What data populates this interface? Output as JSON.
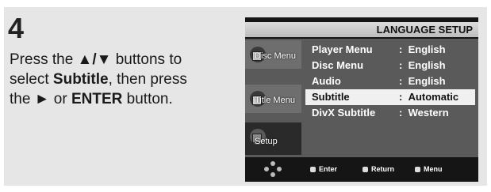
{
  "step": {
    "number": "4"
  },
  "instructions": {
    "line1_pre": "Press the ",
    "arrows": "▲/▼",
    "line1_post": " buttons to",
    "line2_pre": "select ",
    "line2_bold": "Subtitle",
    "line2_post": ", then press",
    "line3_pre": "the ",
    "line3_arrow": "►",
    "line3_mid": " or ",
    "line3_bold": "ENTER",
    "line3_post": " button."
  },
  "osd": {
    "title": "LANGUAGE SETUP",
    "side_tabs": [
      {
        "label": "Disc Menu",
        "icon": "disc-menu-icon"
      },
      {
        "label": "Title Menu",
        "icon": "title-menu-icon"
      },
      {
        "label": "Setup",
        "icon": "setup-icon"
      }
    ],
    "menu": [
      {
        "label": "Player Menu",
        "sep": ":",
        "value": "English",
        "selected": false
      },
      {
        "label": "Disc Menu",
        "sep": ":",
        "value": "English",
        "selected": false
      },
      {
        "label": "Audio",
        "sep": ":",
        "value": "English",
        "selected": false
      },
      {
        "label": "Subtitle",
        "sep": ":",
        "value": "Automatic",
        "selected": true
      },
      {
        "label": "DivX Subtitle",
        "sep": ":",
        "value": "Western",
        "selected": false
      }
    ],
    "footer": {
      "enter": "Enter",
      "return": "Return",
      "menu": "Menu"
    }
  }
}
